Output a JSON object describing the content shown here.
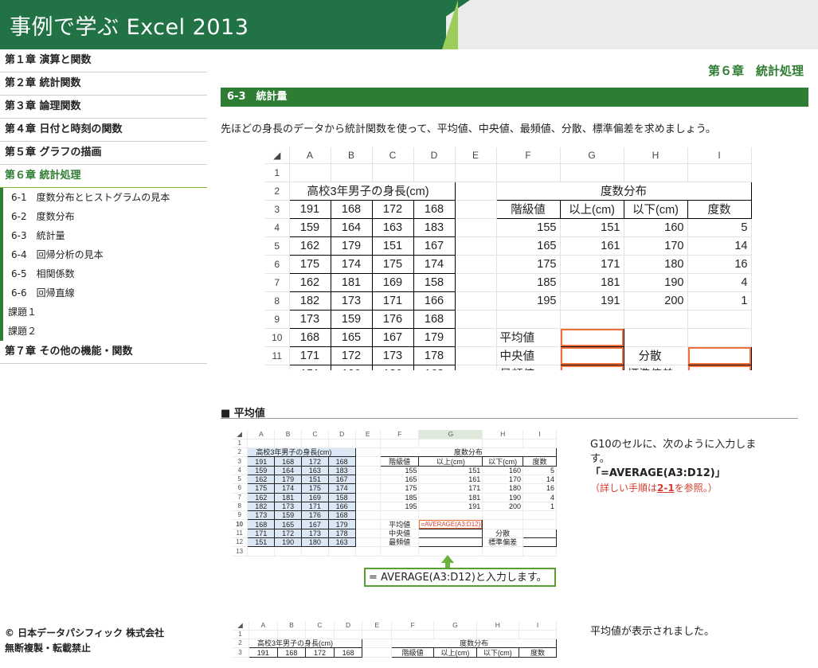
{
  "header": {
    "title": "事例で学ぶ Excel 2013"
  },
  "sidebar": {
    "chapters_top": [
      "第１章 演算と関数",
      "第２章 統計関数",
      "第３章 論理関数",
      "第４章 日付と時刻の関数",
      "第５章 グラフの描画"
    ],
    "active_chapter": "第６章 統計処理",
    "subitems": [
      "6-1　度数分布とヒストグラムの見本",
      "6-2　度数分布",
      "6-3　統計量",
      "6-4　回帰分析の見本",
      "6-5　相関係数",
      "6-6　回帰直線"
    ],
    "tasks": [
      "課題１",
      "課題２"
    ],
    "chapter_bottom": "第７章 その他の機能・関数",
    "copyright_line1": "© 日本データパシフィック 株式会社",
    "copyright_line2": "無断複製・転載禁止"
  },
  "main": {
    "chapter_heading": "第６章　統計処理",
    "section_title": "6-3　統計量",
    "intro": "先ほどの身長のデータから統計関数を使って、平均値、中央値、最頻値、分散、標準偏差を求めましょう。",
    "subsection_title": "■ 平均値",
    "note_line1": "G10のセルに、次のように入力しま",
    "note_line2": "す。",
    "note_formula": "「=AVERAGE(A3:D12)」",
    "note_ref_prefix": "（詳しい手順は",
    "note_ref_link": "2-1",
    "note_ref_suffix": "を参照。）",
    "callout": "= AVERAGE(A3:D12)と入力します。",
    "note_result": "平均値が表示されました。",
    "formula_in_cell": "=AVERAGE(A3:D12)"
  },
  "sheet": {
    "col_headers": [
      "A",
      "B",
      "C",
      "D",
      "E",
      "F",
      "G",
      "H",
      "I"
    ],
    "row_numbers": [
      "1",
      "2",
      "3",
      "4",
      "5",
      "6",
      "7",
      "8",
      "9",
      "10",
      "11",
      "12",
      "13"
    ],
    "data_title": "高校3年男子の身長(cm)",
    "heights": [
      [
        "191",
        "168",
        "172",
        "168"
      ],
      [
        "159",
        "164",
        "163",
        "183"
      ],
      [
        "162",
        "179",
        "151",
        "167"
      ],
      [
        "175",
        "174",
        "175",
        "174"
      ],
      [
        "162",
        "181",
        "169",
        "158"
      ],
      [
        "182",
        "173",
        "171",
        "166"
      ],
      [
        "173",
        "159",
        "176",
        "168"
      ],
      [
        "168",
        "165",
        "167",
        "179"
      ],
      [
        "171",
        "172",
        "173",
        "178"
      ],
      [
        "151",
        "190",
        "180",
        "163"
      ]
    ],
    "freq_title": "度数分布",
    "freq_headers": [
      "階級値",
      "以上(cm)",
      "以下(cm)",
      "度数"
    ],
    "freq_rows": [
      [
        "155",
        "151",
        "160",
        "5"
      ],
      [
        "165",
        "161",
        "170",
        "14"
      ],
      [
        "175",
        "171",
        "180",
        "16"
      ],
      [
        "185",
        "181",
        "190",
        "4"
      ],
      [
        "195",
        "191",
        "200",
        "1"
      ]
    ],
    "stats_labels": [
      "平均値",
      "中央値",
      "最頻値"
    ],
    "stats_labels_right": [
      "分散",
      "標準偏差"
    ]
  }
}
